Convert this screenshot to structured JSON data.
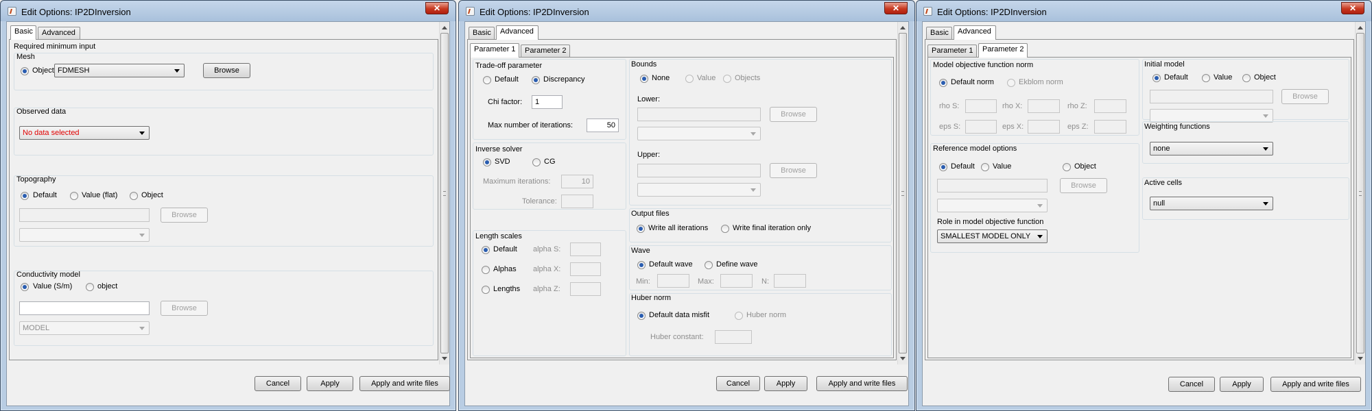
{
  "windows": [
    {
      "title": "Edit Options: IP2DInversion",
      "close_label": "✕",
      "tabs": [
        "Basic",
        "Advanced"
      ],
      "selected_tab": "Basic",
      "section_title": "Required minimum input",
      "mesh": {
        "title": "Mesh",
        "radio": "Object",
        "value": "FDMESH",
        "browse": "Browse"
      },
      "observed": {
        "title": "Observed data",
        "value": "No data selected"
      },
      "topography": {
        "title": "Topography",
        "options": [
          "Default",
          "Value (flat)",
          "Object"
        ],
        "selected": "Default",
        "browse": "Browse"
      },
      "conductivity": {
        "title": "Conductivity model",
        "options": [
          "Value (S/m)",
          "object"
        ],
        "selected": "Value (S/m)",
        "browse": "Browse",
        "combo": "MODEL"
      },
      "footer": {
        "cancel": "Cancel",
        "apply": "Apply",
        "apply_write": "Apply and write files"
      }
    },
    {
      "title": "Edit Options: IP2DInversion",
      "close_label": "✕",
      "tabs": [
        "Basic",
        "Advanced"
      ],
      "selected_tab": "Advanced",
      "subtabs": [
        "Parameter 1",
        "Parameter 2"
      ],
      "selected_subtab": "Parameter 1",
      "tradeoff": {
        "title": "Trade-off parameter",
        "options": [
          "Default",
          "Discrepancy"
        ],
        "selected": "Discrepancy",
        "chi_label": "Chi factor:",
        "chi_value": "1",
        "max_iter_label": "Max number of iterations:",
        "max_iter_value": "50"
      },
      "inverse": {
        "title": "Inverse solver",
        "options": [
          "SVD",
          "CG"
        ],
        "selected": "SVD",
        "max_label": "Maximum iterations:",
        "max_value": "10",
        "tol_label": "Tolerance:"
      },
      "length": {
        "title": "Length scales",
        "options": [
          "Default",
          "Alphas",
          "Lengths"
        ],
        "selected": "Default",
        "alphas": [
          "alpha S:",
          "alpha X:",
          "alpha Z:"
        ]
      },
      "bounds": {
        "title": "Bounds",
        "options": [
          "None",
          "Value",
          "Objects"
        ],
        "selected": "None",
        "lower": "Lower:",
        "upper": "Upper:",
        "browse": "Browse"
      },
      "output": {
        "title": "Output files",
        "options": [
          "Write all iterations",
          "Write final iteration only"
        ],
        "selected": "Write all iterations"
      },
      "wave": {
        "title": "Wave",
        "options": [
          "Default wave",
          "Define wave"
        ],
        "selected": "Default wave",
        "min": "Min:",
        "max": "Max:",
        "n": "N:"
      },
      "huber": {
        "title": "Huber norm",
        "options": [
          "Default data misfit",
          "Huber norm"
        ],
        "selected": "Default data misfit",
        "constant": "Huber constant:"
      },
      "footer": {
        "cancel": "Cancel",
        "apply": "Apply",
        "apply_write": "Apply and write files"
      }
    },
    {
      "title": "Edit Options: IP2DInversion",
      "close_label": "✕",
      "tabs": [
        "Basic",
        "Advanced"
      ],
      "selected_tab": "Advanced",
      "subtabs": [
        "Parameter 1",
        "Parameter 2"
      ],
      "selected_subtab": "Parameter 2",
      "norm": {
        "title": "Model objective function norm",
        "options": [
          "Default norm",
          "Ekblom norm"
        ],
        "selected": "Default norm",
        "rho": [
          "rho S:",
          "rho X:",
          "rho Z:"
        ],
        "eps": [
          "eps S:",
          "eps X:",
          "eps Z:"
        ]
      },
      "reference": {
        "title": "Reference model options",
        "options": [
          "Default",
          "Value",
          "Object"
        ],
        "selected": "Default",
        "browse": "Browse",
        "role_label": "Role in model objective function",
        "role_value": "SMALLEST MODEL ONLY"
      },
      "initial": {
        "title": "Initial model",
        "options": [
          "Default",
          "Value",
          "Object"
        ],
        "selected": "Default",
        "browse": "Browse"
      },
      "weighting": {
        "title": "Weighting functions",
        "value": "none"
      },
      "active": {
        "title": "Active cells",
        "value": "null"
      },
      "footer": {
        "cancel": "Cancel",
        "apply": "Apply",
        "apply_write": "Apply and write files"
      }
    }
  ]
}
